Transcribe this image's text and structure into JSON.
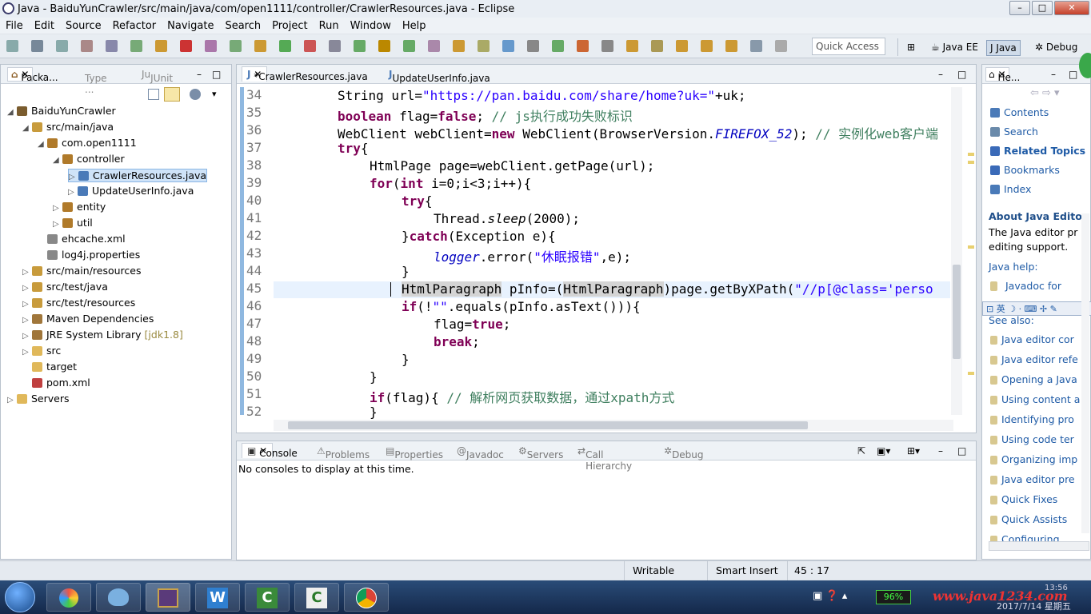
{
  "window": {
    "title": "Java - BaiduYunCrawler/src/main/java/com/open1111/controller/CrawlerResources.java - Eclipse"
  },
  "menu": [
    "File",
    "Edit",
    "Source",
    "Refactor",
    "Navigate",
    "Search",
    "Project",
    "Run",
    "Window",
    "Help"
  ],
  "quick_access": "Quick Access",
  "perspectives": [
    "Java EE",
    "Java",
    "Debug"
  ],
  "left_tabs": [
    "Packa...",
    "Type ...",
    "JUnit"
  ],
  "tree": [
    {
      "label": "BaiduYunCrawler",
      "depth": 0,
      "icon": "project-icon",
      "color": "#7a5c2e"
    },
    {
      "label": "src/main/java",
      "depth": 1,
      "icon": "source-folder-icon",
      "color": "#c89b3c"
    },
    {
      "label": "com.open1111",
      "depth": 2,
      "icon": "package-icon",
      "color": "#b07a2a"
    },
    {
      "label": "controller",
      "depth": 3,
      "icon": "package-icon",
      "color": "#b07a2a"
    },
    {
      "label": "CrawlerResources.java",
      "depth": 4,
      "icon": "java-file-icon",
      "color": "#4a7ab8",
      "selected": true
    },
    {
      "label": "UpdateUserInfo.java",
      "depth": 4,
      "icon": "java-file-icon",
      "color": "#4a7ab8"
    },
    {
      "label": "entity",
      "depth": 3,
      "icon": "package-icon",
      "color": "#b07a2a"
    },
    {
      "label": "util",
      "depth": 3,
      "icon": "package-icon",
      "color": "#b07a2a"
    },
    {
      "label": "ehcache.xml",
      "depth": 2,
      "icon": "xml-file-icon",
      "color": "#888888"
    },
    {
      "label": "log4j.properties",
      "depth": 2,
      "icon": "properties-file-icon",
      "color": "#888888"
    },
    {
      "label": "src/main/resources",
      "depth": 1,
      "icon": "source-folder-icon",
      "color": "#c89b3c"
    },
    {
      "label": "src/test/java",
      "depth": 1,
      "icon": "source-folder-icon",
      "color": "#c89b3c"
    },
    {
      "label": "src/test/resources",
      "depth": 1,
      "icon": "source-folder-icon",
      "color": "#c89b3c"
    },
    {
      "label": "Maven Dependencies",
      "depth": 1,
      "icon": "library-icon",
      "color": "#a0763a"
    },
    {
      "label": "JRE System Library",
      "suffix": "[jdk1.8]",
      "depth": 1,
      "icon": "library-icon",
      "color": "#a0763a"
    },
    {
      "label": "src",
      "depth": 1,
      "icon": "folder-icon",
      "color": "#e0b85a"
    },
    {
      "label": "target",
      "depth": 1,
      "icon": "folder-icon",
      "color": "#e0b85a"
    },
    {
      "label": "pom.xml",
      "depth": 1,
      "icon": "xml-file-icon",
      "color": "#c04040"
    },
    {
      "label": "Servers",
      "depth": 0,
      "icon": "folder-icon",
      "color": "#e0b85a"
    }
  ],
  "editor_tabs": [
    "*CrawlerResources.java",
    "UpdateUserInfo.java"
  ],
  "code": [
    {
      "n": "34",
      "html": "String url=<span class='st'>\"https://pan.baidu.com/share/home?uk=\"</span>+uk;",
      "indent": 0
    },
    {
      "n": "35",
      "html": "<span class='kw'>boolean</span> flag=<span class='kw'>false</span>; <span class='cm'>// js执行成功失败标识</span>",
      "indent": 0
    },
    {
      "n": "36",
      "html": "WebClient webClient=<span class='kw'>new</span> WebClient(BrowserVersion.<span class='fi'>FIREFOX_52</span>); <span class='cm'>// 实例化web客户端</span>",
      "indent": 0
    },
    {
      "n": "37",
      "html": "<span class='kw'>try</span>{",
      "indent": 0
    },
    {
      "n": "38",
      "html": "HtmlPage page=webClient.getPage(url);",
      "indent": 1
    },
    {
      "n": "39",
      "html": "<span class='kw'>for</span>(<span class='kw'>int</span> i=0;i&lt;3;i++){",
      "indent": 1
    },
    {
      "n": "40",
      "html": "<span class='kw'>try</span>{",
      "indent": 2
    },
    {
      "n": "41",
      "html": "Thread.<span class='it'>sleep</span>(2000);",
      "indent": 3
    },
    {
      "n": "42",
      "html": "}<span class='kw'>catch</span>(Exception e){",
      "indent": 2
    },
    {
      "n": "43",
      "html": "<span class='fi'>logger</span>.error(<span class='st'>\"休眠报错\"</span>,e);",
      "indent": 3
    },
    {
      "n": "44",
      "html": "}",
      "indent": 2
    },
    {
      "n": "45",
      "html": "HtmlParagraph pInfo=(HtmlParagraph)page.getByXPath(<span class='st'>\"//p[@class='perso</span>",
      "indent": 2,
      "current": true
    },
    {
      "n": "46",
      "html": "<span class='kw'>if</span>(!<span class='st'>\"\"</span>.equals(pInfo.asText())){",
      "indent": 2
    },
    {
      "n": "47",
      "html": "flag=<span class='kw'>true</span>;",
      "indent": 3
    },
    {
      "n": "48",
      "html": "<span class='kw'>break</span>;",
      "indent": 3
    },
    {
      "n": "49",
      "html": "}",
      "indent": 2
    },
    {
      "n": "50",
      "html": "}",
      "indent": 1
    },
    {
      "n": "51",
      "html": "<span class='kw'>if</span>(flag){ <span class='cm'>// 解析网页获取数据，通过xpath方式</span>",
      "indent": 1
    },
    {
      "n": "52",
      "html": "}",
      "indent": 1
    }
  ],
  "bottom_tabs": [
    "Console",
    "Problems",
    "Properties",
    "Javadoc",
    "Servers",
    "Call Hierarchy",
    "Debug"
  ],
  "console_text": "No consoles to display at this time.",
  "help": {
    "tab": "He...",
    "nav": [
      "Contents",
      "Search",
      "Related Topics",
      "Bookmarks",
      "Index"
    ],
    "heading": "About Java Editor",
    "text1": "The Java editor pr",
    "text2": "editing support.",
    "java_help": "Java help:",
    "javadoc_link": "Javadoc for",
    "see_also": "See also:",
    "links": [
      "Java editor cor",
      "Java editor refe",
      "Opening a Java",
      "Using content a",
      "Identifying pro",
      "Using code ter",
      "Organizing imp",
      "Java editor pre",
      "Quick Fixes",
      "Quick Assists",
      "Configuring"
    ]
  },
  "status": {
    "writable": "Writable",
    "insert": "Smart Insert",
    "position": "45 : 17"
  },
  "taskbar": {
    "battery": "96%",
    "watermark": "www.java1234.com",
    "date": "2017/7/14 星期五",
    "time": "13:56"
  }
}
